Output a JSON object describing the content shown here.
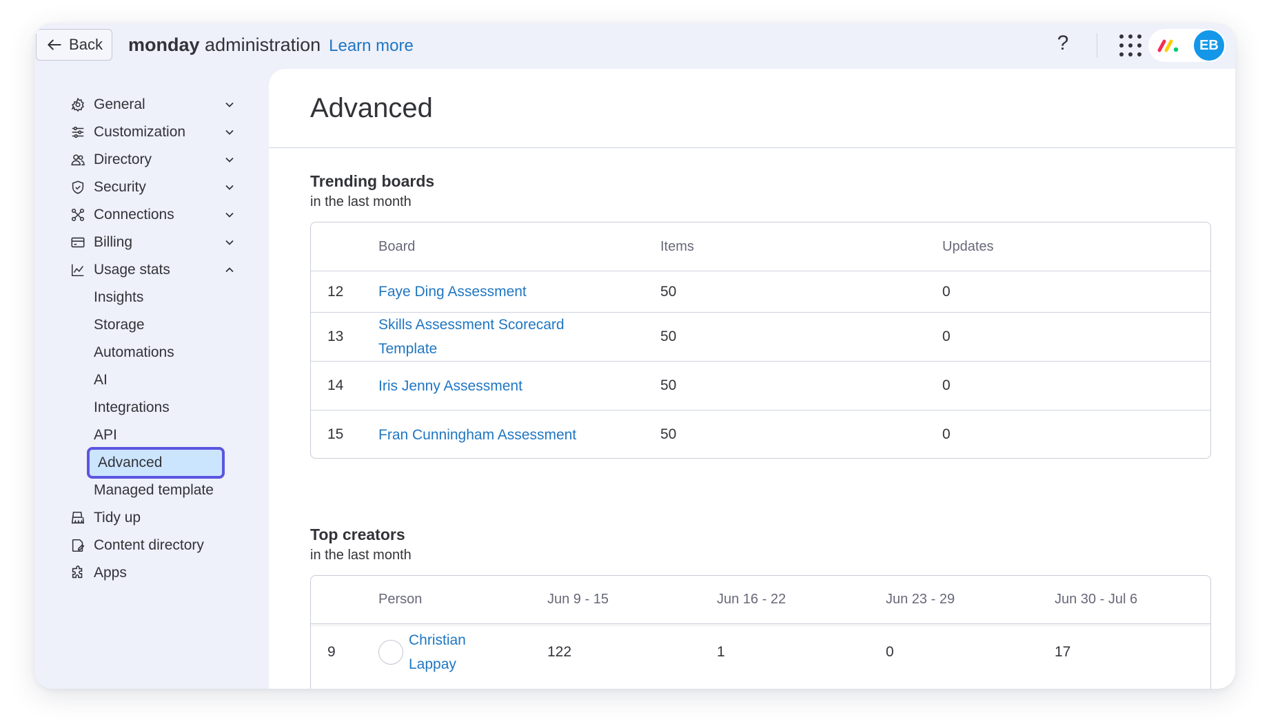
{
  "topbar": {
    "back_label": "Back",
    "brand": "monday",
    "title": "administration",
    "learn_more": "Learn more",
    "help": "?",
    "avatar_initials": "EB",
    "avatar_color": "#1497e9"
  },
  "sidebar": {
    "items": [
      {
        "label": "General",
        "icon": "gear-icon",
        "expanded": false
      },
      {
        "label": "Customization",
        "icon": "sliders-icon",
        "expanded": false
      },
      {
        "label": "Directory",
        "icon": "users-icon",
        "expanded": false
      },
      {
        "label": "Security",
        "icon": "shield-icon",
        "expanded": false
      },
      {
        "label": "Connections",
        "icon": "connections-icon",
        "expanded": false
      },
      {
        "label": "Billing",
        "icon": "credit-card-icon",
        "expanded": false
      },
      {
        "label": "Usage stats",
        "icon": "chart-icon",
        "expanded": true
      }
    ],
    "usage_sub": [
      "Insights",
      "Storage",
      "Automations",
      "AI",
      "Integrations",
      "API",
      "Advanced",
      "Managed template"
    ],
    "active_sub": "Advanced",
    "bottom_items": [
      {
        "label": "Tidy up",
        "icon": "broom-icon"
      },
      {
        "label": "Content directory",
        "icon": "content-directory-icon"
      },
      {
        "label": "Apps",
        "icon": "puzzle-icon"
      }
    ]
  },
  "main": {
    "title": "Advanced",
    "trending": {
      "title": "Trending boards",
      "subtitle": "in the last month",
      "columns": [
        "Board",
        "Items",
        "Updates"
      ],
      "rows": [
        {
          "rank": "12",
          "board": "Faye Ding Assessment",
          "items": "50",
          "updates": "0"
        },
        {
          "rank": "13",
          "board": "Skills Assessment Scorecard Template",
          "items": "50",
          "updates": "0"
        },
        {
          "rank": "14",
          "board": "Iris Jenny Assessment",
          "items": "50",
          "updates": "0"
        },
        {
          "rank": "15",
          "board": "Fran Cunningham Assessment",
          "items": "50",
          "updates": "0"
        }
      ]
    },
    "creators": {
      "title": "Top creators",
      "subtitle": "in the last month",
      "columns": [
        "Person",
        "Jun 9 - 15",
        "Jun 16 - 22",
        "Jun 23 - 29",
        "Jun 30 - Jul 6"
      ],
      "rows": [
        {
          "rank": "9",
          "person": "Christian Lappay",
          "w1": "122",
          "w2": "1",
          "w3": "0",
          "w4": "17"
        }
      ]
    }
  },
  "colors": {
    "link": "#1f76c2",
    "active_bg": "#cce5ff",
    "active_border": "#5b55e0",
    "sidebar_bg": "#eef0fa"
  }
}
